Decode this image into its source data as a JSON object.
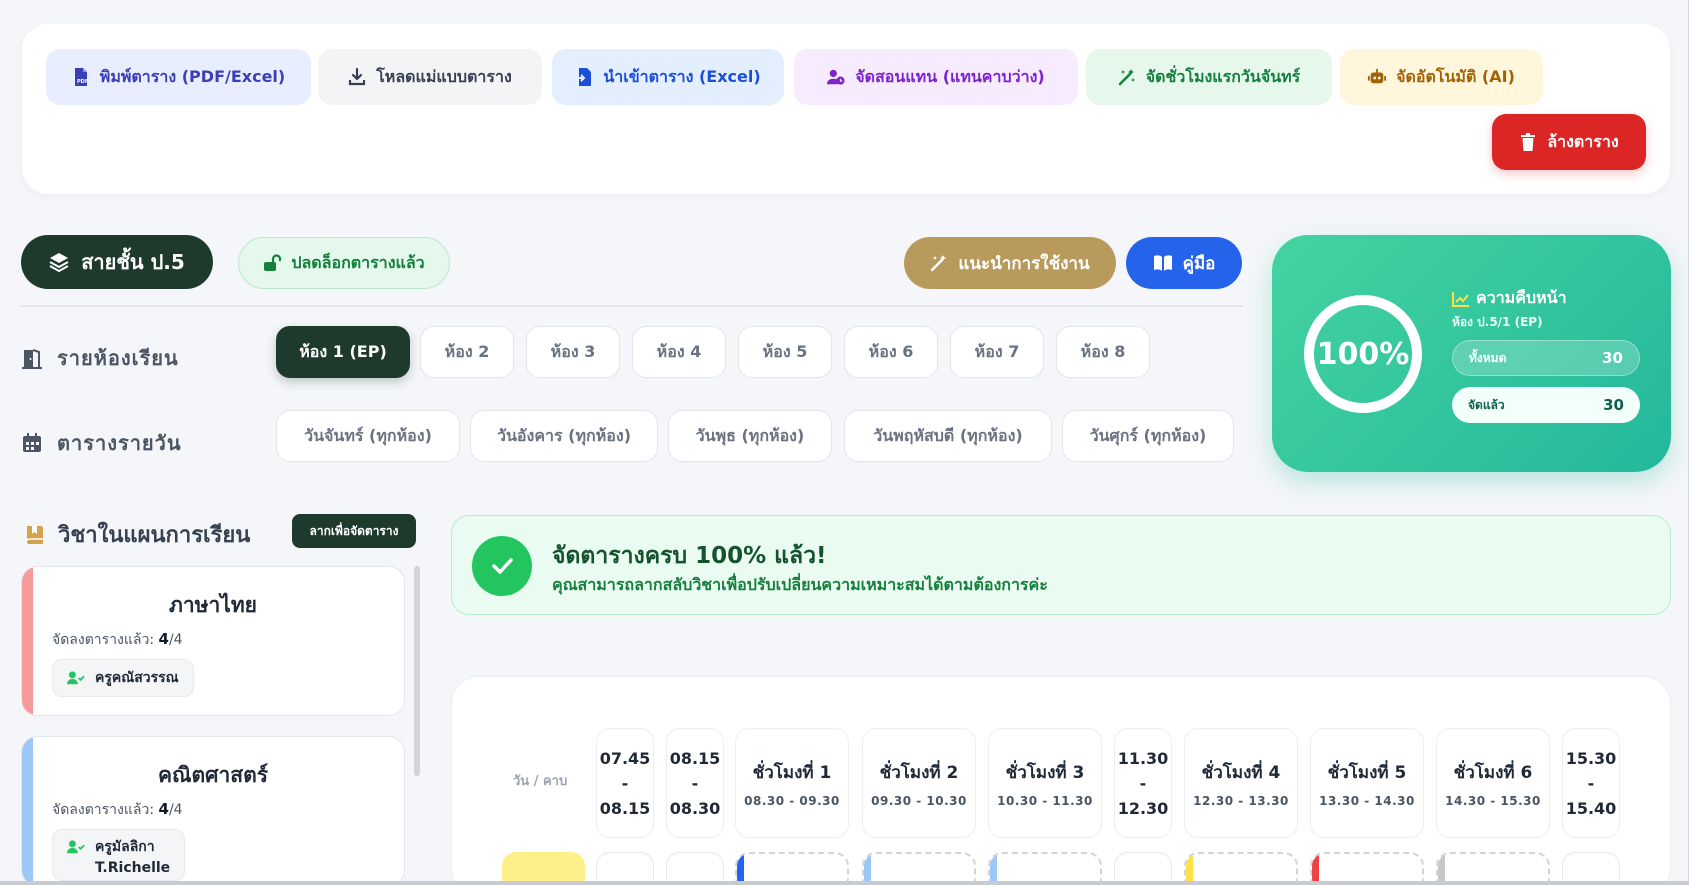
{
  "toolbar": {
    "print_label": "พิมพ์ตาราง (PDF/Excel)",
    "download_label": "โหลดแม่แบบตาราง",
    "import_label": "นำเข้าตาราง (Excel)",
    "substitute_label": "จัดสอนแทน (แทนคาบว่าง)",
    "monday_label": "จัดชั่วโมงแรกวันจันทร์",
    "auto_label": "จัดอัตโนมัติ (AI)",
    "clear_label": "ล้างตาราง"
  },
  "controls": {
    "grade_label": "สายชั้น ป.5",
    "unlock_label": "ปลดล็อกตารางแล้ว",
    "guide_label": "แนะนำการใช้งาน",
    "manual_label": "คู่มือ"
  },
  "rooms": {
    "label": "รายห้องเรียน",
    "items": [
      "ห้อง 1 (EP)",
      "ห้อง 2",
      "ห้อง 3",
      "ห้อง 4",
      "ห้อง 5",
      "ห้อง 6",
      "ห้อง 7",
      "ห้อง 8"
    ],
    "active_index": 0
  },
  "daily": {
    "label": "ตารางรายวัน",
    "items": [
      "วันจันทร์ (ทุกห้อง)",
      "วันอังคาร (ทุกห้อง)",
      "วันพุธ (ทุกห้อง)",
      "วันพฤหัสบดี (ทุกห้อง)",
      "วันศุกร์ (ทุกห้อง)"
    ]
  },
  "progress": {
    "percent_text": "100%",
    "percent_value": 1.0,
    "title": "ความคืบหน้า",
    "room": "ห้อง ป.5/1 (EP)",
    "total_label": "ทั้งหมด",
    "total_value": "30",
    "done_label": "จัดแล้ว",
    "done_value": "30"
  },
  "subjects": {
    "title": "วิชาในแผนการเรียน",
    "drag_badge": "ลากเพื่อจัดตาราง",
    "count_prefix": "จัดลงตารางแล้ว:",
    "items": [
      {
        "name": "ภาษาไทย",
        "done": "4",
        "total": "/4",
        "teacher": "ครูคณัสวรรณ",
        "teacher2": "",
        "color": "#f69a9a"
      },
      {
        "name": "คณิตศาสตร์",
        "done": "4",
        "total": "/4",
        "teacher": "ครูมัลลิกา",
        "teacher2": "T.Richelle",
        "color": "#9cc8f5"
      }
    ]
  },
  "banner": {
    "headline": "จัดตารางครบ 100% แล้ว!",
    "sub": "คุณสามารถลากสลับวิชาเพื่อปรับเปลี่ยนความเหมาะสมได้ตามต้องการค่ะ"
  },
  "timetable": {
    "day_period_label": "วัน / คาบ",
    "slots": [
      {
        "kind": "break",
        "l1": "07.45",
        "l2": "-",
        "l3": "08.15"
      },
      {
        "kind": "break",
        "l1": "08.15",
        "l2": "-",
        "l3": "08.30"
      },
      {
        "kind": "period",
        "name": "ชั่วโมงที่ 1",
        "time": "08.30 - 09.30"
      },
      {
        "kind": "period",
        "name": "ชั่วโมงที่ 2",
        "time": "09.30 - 10.30"
      },
      {
        "kind": "period",
        "name": "ชั่วโมงที่ 3",
        "time": "10.30 - 11.30"
      },
      {
        "kind": "break",
        "l1": "11.30",
        "l2": "-",
        "l3": "12.30"
      },
      {
        "kind": "period",
        "name": "ชั่วโมงที่ 4",
        "time": "12.30 - 13.30"
      },
      {
        "kind": "period",
        "name": "ชั่วโมงที่ 5",
        "time": "13.30 - 14.30"
      },
      {
        "kind": "period",
        "name": "ชั่วโมงที่ 6",
        "time": "14.30 - 15.30"
      },
      {
        "kind": "break",
        "l1": "15.30",
        "l2": "-",
        "l3": "15.40"
      }
    ]
  },
  "colors": {
    "dark_green": "#1e3a2c",
    "danger": "#dc2626",
    "primary": "#2563eb",
    "gold": "#b89a5c",
    "success": "#22c55e"
  }
}
